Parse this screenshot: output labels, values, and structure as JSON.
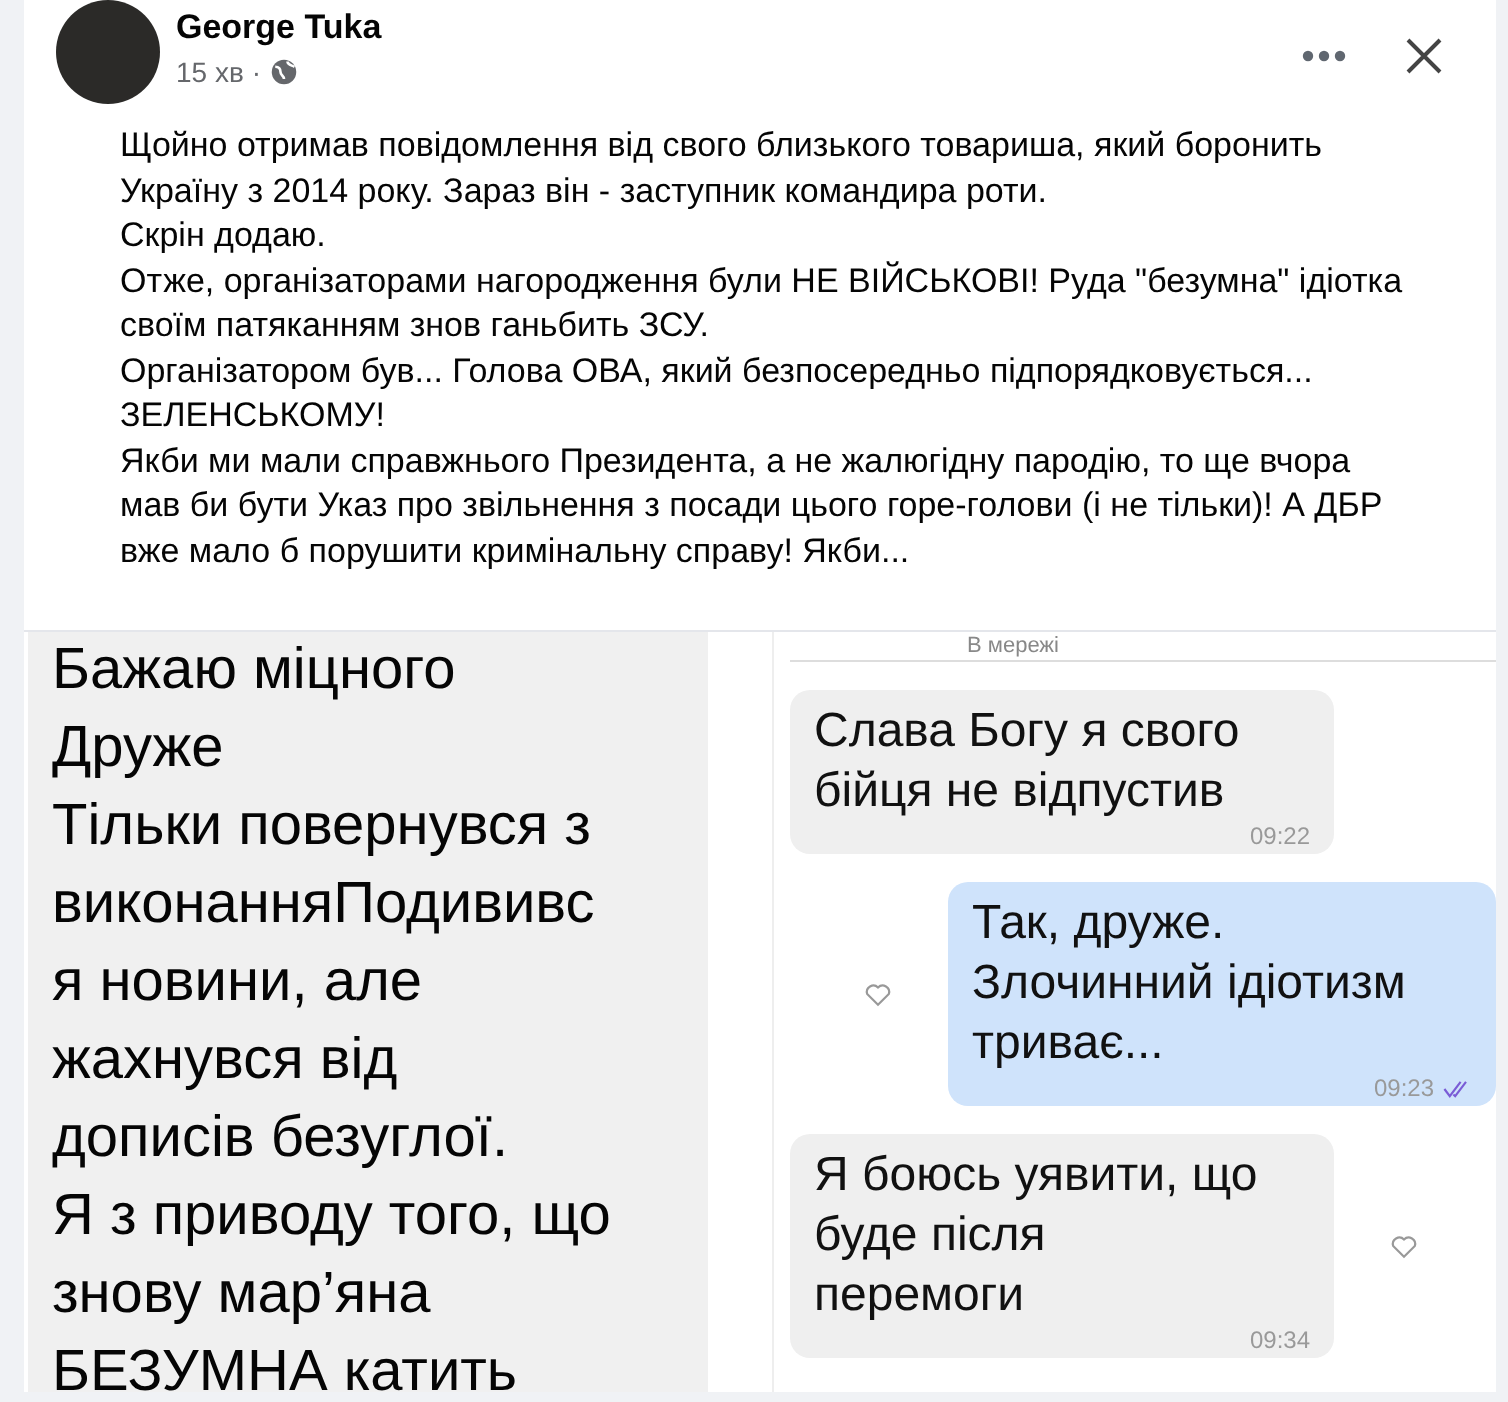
{
  "post": {
    "author": "George Tuka",
    "time": "15 хв",
    "separator": "·",
    "paragraphs": [
      "Щойно отримав повідомлення від свого близького товариша, який боронить Україну з 2014 року. Зараз він - заступник командира роти.",
      "Скрін додаю.",
      "Отже, організаторами нагородження були НЕ ВІЙСЬКОВІ! Руда \"безумна\" ідіотка своїм патяканням знов ганьбить ЗСУ.",
      "Організатором був... Голова ОВА, який безпосередньо підпорядковується... ЗЕЛЕНСЬКОМУ!",
      "Якби ми мали справжнього Президента, а не жалюгідну пародію, то ще вчора мав би бути Указ про звільнення з посади цього горе-голови (і не тільки)! А ДБР вже мало б порушити кримінальну справу! Якби..."
    ]
  },
  "left_screenshot": {
    "lines": [
      "Бажаю міцного",
      "Друже",
      "Тільки повернувся з",
      "виконанняПодививс",
      "я новини, але",
      "жахнувся від",
      "дописів безуглої.",
      "Я з приводу того, що",
      "знову мар’яна",
      "БЕЗУМНА катить"
    ]
  },
  "right_screenshot": {
    "status": "В мережі",
    "messages": [
      {
        "kind": "in",
        "lines": [
          "Слава Богу я свого",
          "бійця не відпустив"
        ],
        "time": "09:22",
        "heart": false
      },
      {
        "kind": "out",
        "lines": [
          "Так, друже.",
          "Злочинний ідіотизм",
          "триває..."
        ],
        "time": "09:23",
        "heart": true
      },
      {
        "kind": "in",
        "lines": [
          "Я боюсь уявити, що",
          "буде після",
          "перемоги"
        ],
        "time": "09:34",
        "heart": true
      }
    ]
  }
}
